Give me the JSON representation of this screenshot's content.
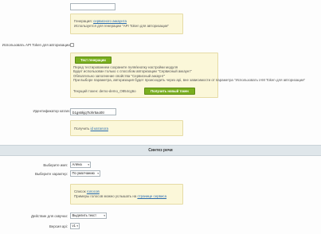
{
  "service_account": {
    "label": "Сервисный аккаунт:",
    "value": ""
  },
  "note1": {
    "line1_prefix": "Генерация: ",
    "line1_link": "сервисного аккаунта",
    "line2": "Используется для генерации \"API Token для авторизации\""
  },
  "use_api_token": {
    "label": "Использовать API Token для авторизации:",
    "checked": false
  },
  "note2": {
    "test_button": "Тест генерации",
    "lines": [
      "Перед тестированием сохраните поля/кнопку настройки модуля",
      "Будет использован только с способом авторизации \"Сервисный аккаунт\"",
      "Обязательно заполнение свойства \"Сервисный аккаунт\"",
      "При выборе параметра, авторизация будет происходить через api, вне зависимости от параметра \"Использовать IAM Token для авторизации\""
    ],
    "current_token_label": "Текущий токен: demo-demo_O854cg6o",
    "get_token_button": "Получить новый токен"
  },
  "catalog_id": {
    "label": "Идентификатор каталога:",
    "value": "b1gs6kjq7tohr5ao0tr"
  },
  "note3": {
    "prefix": "Получить ",
    "link": "id каталога"
  },
  "section_title": "Синтез речи",
  "voice": {
    "label": "Выберите имя:",
    "value": "Алёна"
  },
  "character": {
    "label": "Выберите характер:",
    "value": "По умолчанию"
  },
  "note4": {
    "line1_prefix": "Список ",
    "line1_link": "голосов",
    "line2_prefix": "Примеры голосов можно услышать на ",
    "line2_link": "странице сервиса"
  },
  "action": {
    "label": "Действие для озвучки:",
    "value": "Выделить текст"
  },
  "api_version": {
    "label": "Версия api:",
    "value": "v1"
  }
}
